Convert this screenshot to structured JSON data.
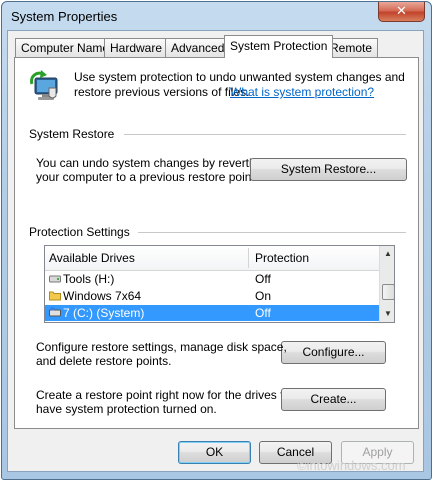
{
  "window": {
    "title": "System Properties"
  },
  "tabs": [
    "Computer Name",
    "Hardware",
    "Advanced",
    "System Protection",
    "Remote"
  ],
  "intro": {
    "text_line1": "Use system protection to undo unwanted system changes and",
    "text_line2": "restore previous versions of files.",
    "link": "What is system protection?"
  },
  "system_restore": {
    "heading": "System Restore",
    "text_line1": "You can undo system changes by reverting",
    "text_line2": "your computer to a previous restore point.",
    "button": "System Restore..."
  },
  "protection": {
    "heading": "Protection Settings",
    "col_drives": "Available Drives",
    "col_protection": "Protection",
    "drives": [
      {
        "name": "Tools (H:)",
        "protection": "Off",
        "icon": "drive-icon"
      },
      {
        "name": "Windows 7x64",
        "protection": "On",
        "icon": "folder-drive-icon"
      },
      {
        "name": "7 (C:) (System)",
        "protection": "Off",
        "icon": "system-drive-icon",
        "selected": true
      }
    ],
    "configure_text_line1": "Configure restore settings, manage disk space,",
    "configure_text_line2": "and delete restore points.",
    "configure_button": "Configure...",
    "create_text_line1": "Create a restore point right now for the drives that",
    "create_text_line2": "have system protection turned on.",
    "create_button": "Create..."
  },
  "footer": {
    "ok": "OK",
    "cancel": "Cancel",
    "apply": "Apply"
  },
  "watermark": "©intowindows.com",
  "colors": {
    "selection": "#3399ff",
    "link": "#0066cc",
    "titlebar": "#b3cde6",
    "close": "#c2432b"
  }
}
